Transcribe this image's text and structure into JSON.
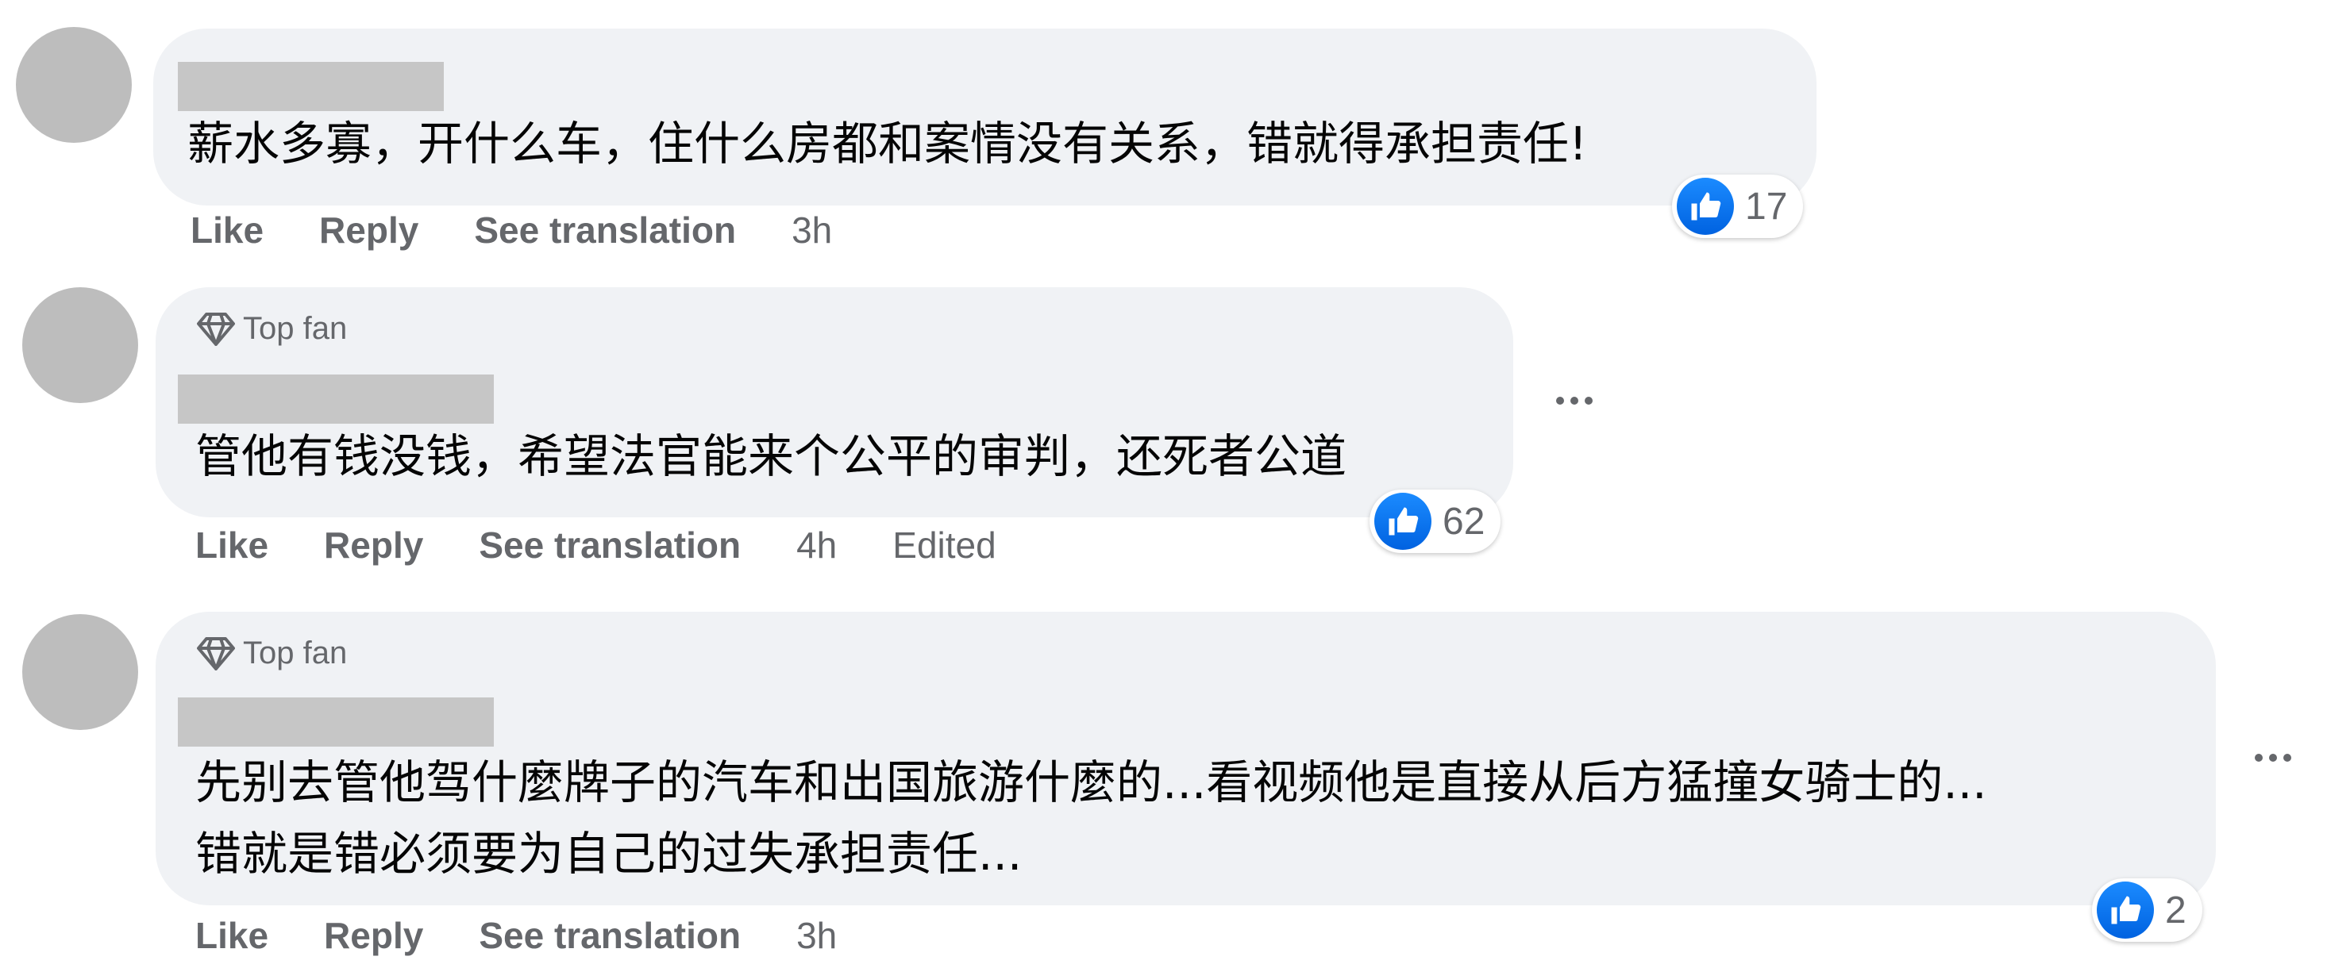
{
  "actions": {
    "like": "Like",
    "reply": "Reply",
    "see_translation": "See translation"
  },
  "comments": [
    {
      "top_fan_label": "",
      "text_lines": [
        "薪水多寡，开什么车，住什么房都和案情没有关系，错就得承担责任!"
      ],
      "time": "3h",
      "edited": "",
      "reaction_icon": "like-icon",
      "reaction_count": "17"
    },
    {
      "top_fan_label": "Top fan",
      "text_lines": [
        "管他有钱没钱，希望法官能来个公平的审判，还死者公道"
      ],
      "time": "4h",
      "edited": "Edited",
      "reaction_icon": "like-icon",
      "reaction_count": "62"
    },
    {
      "top_fan_label": "Top fan",
      "text_lines": [
        "先别去管他驾什麼牌子的汽车和出国旅游什麼的...看视频他是直接从后方猛撞女骑士的...",
        "错就是错必须要为自己的过失承担责任..."
      ],
      "time": "3h",
      "edited": "",
      "reaction_icon": "like-icon",
      "reaction_count": "2"
    }
  ],
  "colors": {
    "bubble": "#f0f2f5",
    "meta_text": "#65676b",
    "like_blue": "#1877f2"
  }
}
